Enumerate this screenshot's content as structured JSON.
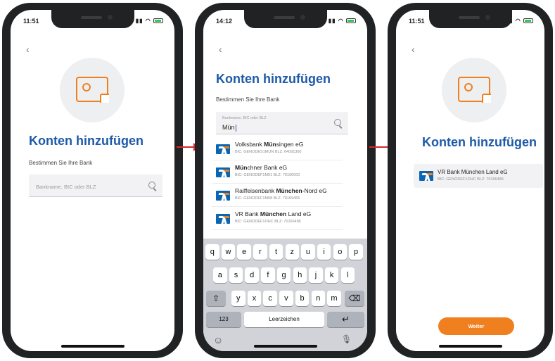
{
  "colors": {
    "brand_blue": "#1d5aa8",
    "accent_orange": "#f07f1f",
    "arrow_red": "#d8262a"
  },
  "screen1": {
    "status_time": "11:51",
    "back_icon": "chevron-left-icon",
    "title": "Konten hinzufügen",
    "subtitle": "Bestimmen Sie Ihre Bank",
    "search_placeholder": "Bankname, BIC oder BLZ"
  },
  "screen2": {
    "status_time": "14:12",
    "title": "Konten hinzufügen",
    "subtitle": "Bestimmen Sie Ihre Bank",
    "search_label": "Bankname, BIC oder BLZ",
    "search_value": "Mün",
    "results": [
      {
        "pre": "Volksbank ",
        "match": "Mün",
        "post": "singen eG",
        "meta": "BIC: GENODES1MUN  BLZ: 64091300"
      },
      {
        "pre": "",
        "match": "Mün",
        "post": "chner Bank eG",
        "meta": "BIC: GENODEF1M01  BLZ: 70190000"
      },
      {
        "pre": "Raiffeisenbank ",
        "match": "München",
        "post": "-Nord eG",
        "meta": "BIC: GENODEF1M08  BLZ: 70169465"
      },
      {
        "pre": "VR Bank ",
        "match": "München",
        "post": " Land eG",
        "meta": "BIC: GENODEF1OHC  BLZ: 70166486"
      }
    ],
    "keyboard": {
      "row1": [
        "q",
        "w",
        "e",
        "r",
        "t",
        "z",
        "u",
        "i",
        "o",
        "p"
      ],
      "row2": [
        "a",
        "s",
        "d",
        "f",
        "g",
        "h",
        "j",
        "k",
        "l"
      ],
      "row3": [
        "y",
        "x",
        "c",
        "v",
        "b",
        "n",
        "m"
      ],
      "shift": "⇧",
      "delete": "⌫",
      "numbers": "123",
      "space": "Leerzeichen",
      "return": "↵",
      "emoji": "☺",
      "mic": "🎙"
    }
  },
  "screen3": {
    "status_time": "11:51",
    "title": "Konten hinzufügen",
    "selected_name": "VR Bank München Land eG",
    "selected_meta": "BIC: GENODEF1OHC  BLZ: 70166486",
    "button": "Weiter"
  }
}
